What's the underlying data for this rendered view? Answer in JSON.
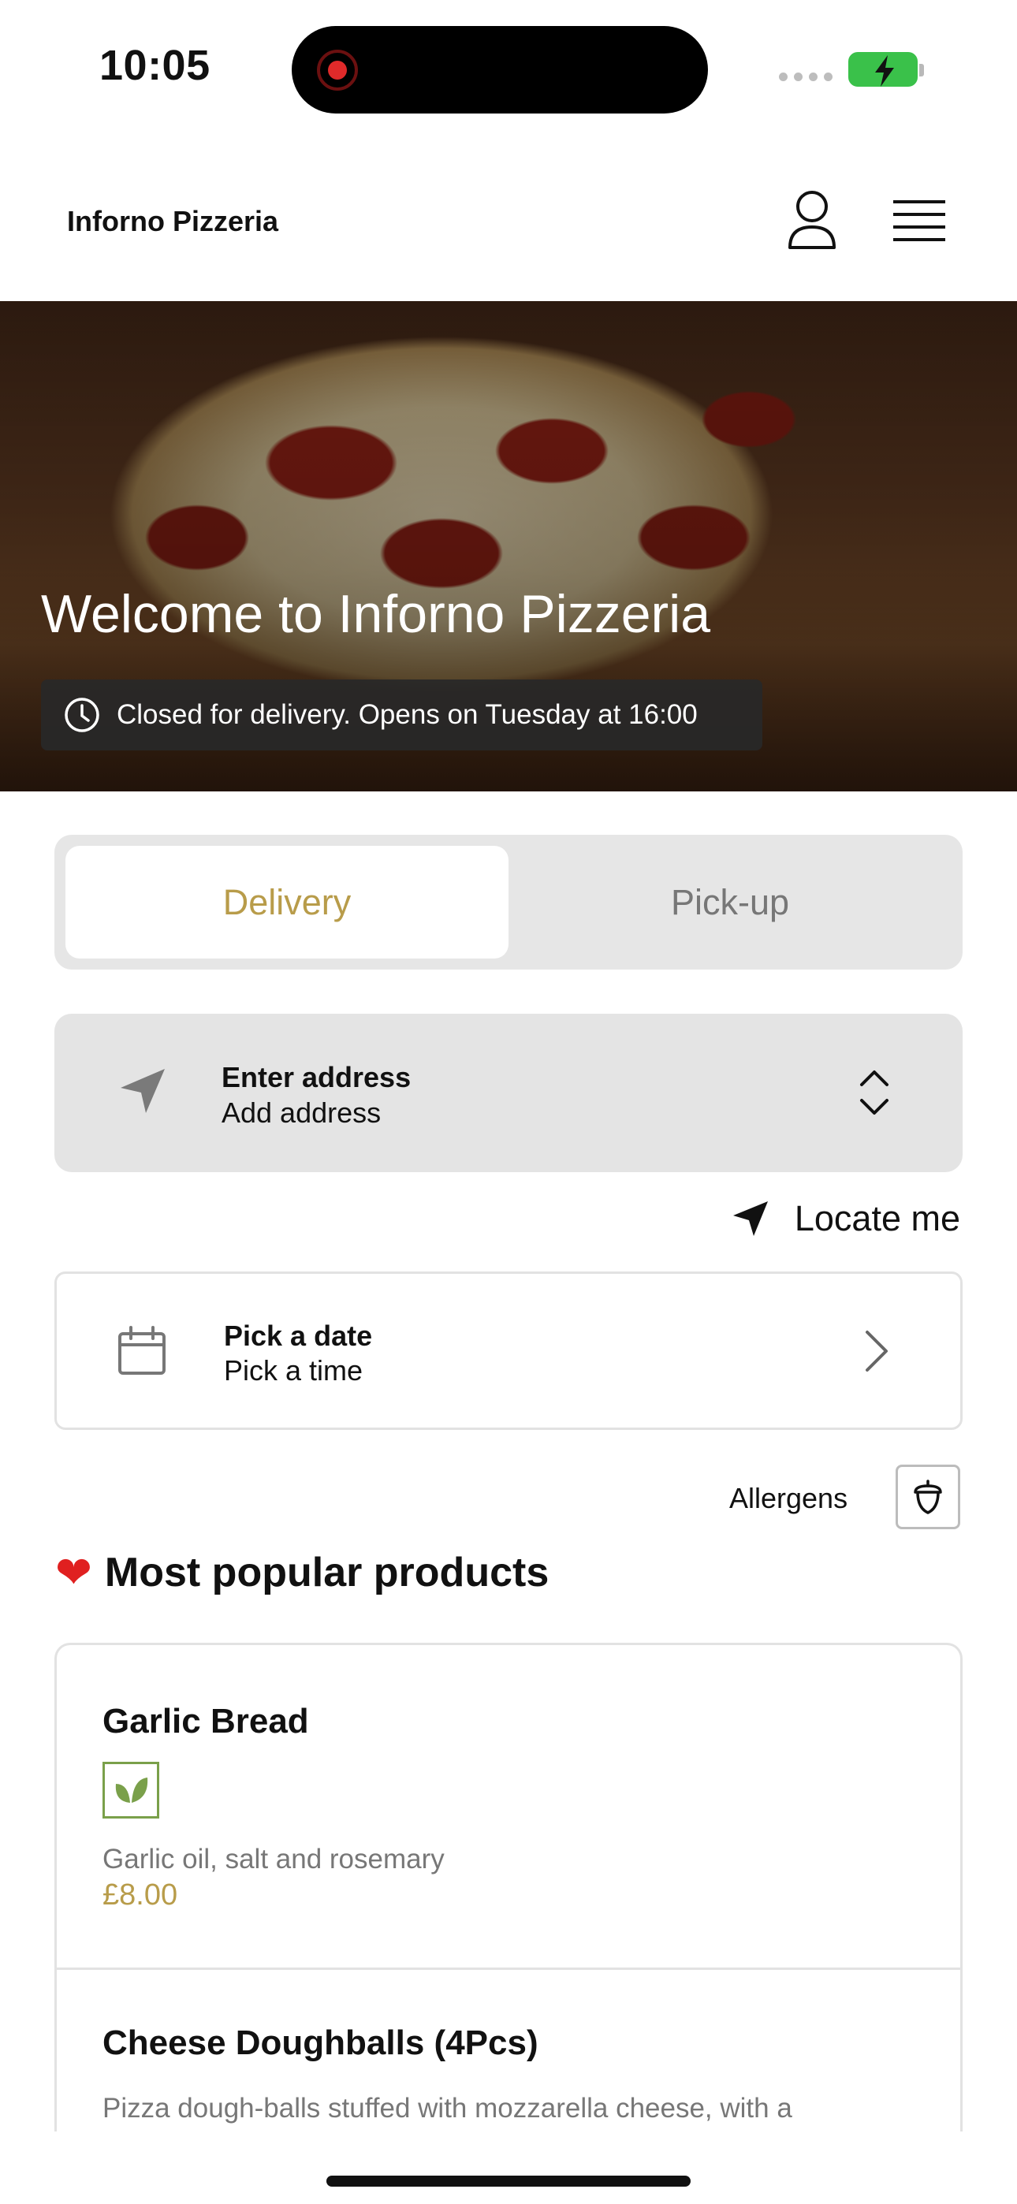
{
  "status_bar": {
    "time": "10:05"
  },
  "header": {
    "title": "Inforno Pizzeria",
    "account_icon": "person-icon",
    "menu_icon": "hamburger-menu-icon"
  },
  "hero": {
    "title": "Welcome to Inforno Pizzeria",
    "status": "Closed for delivery. Opens on Tuesday at 16:00",
    "status_icon": "clock-icon"
  },
  "order_mode": {
    "tabs": [
      {
        "label": "Delivery",
        "selected": true
      },
      {
        "label": "Pick-up",
        "selected": false
      }
    ]
  },
  "address": {
    "title": "Enter address",
    "subtitle": "Add address",
    "icon": "navigation-arrow-icon"
  },
  "locate": {
    "label": "Locate me",
    "icon": "location-arrow-icon"
  },
  "schedule": {
    "title": "Pick a date",
    "subtitle": "Pick a time",
    "icon": "calendar-icon"
  },
  "allergens": {
    "label": "Allergens",
    "icon": "acorn-icon"
  },
  "popular": {
    "title": "Most popular products",
    "icon": "heart-icon",
    "products": [
      {
        "name": "Garlic Bread",
        "badge": "vegetarian-leaf-icon",
        "description": "Garlic oil, salt and rosemary",
        "price": "£8.00"
      },
      {
        "name": "Cheese Doughballs (4Pcs)",
        "description": "Pizza dough-balls stuffed with mozzarella cheese, with a"
      }
    ]
  },
  "colors": {
    "accent": "#b89c4a",
    "battery": "#3ac14a",
    "veg_badge": "#7aa04a"
  }
}
